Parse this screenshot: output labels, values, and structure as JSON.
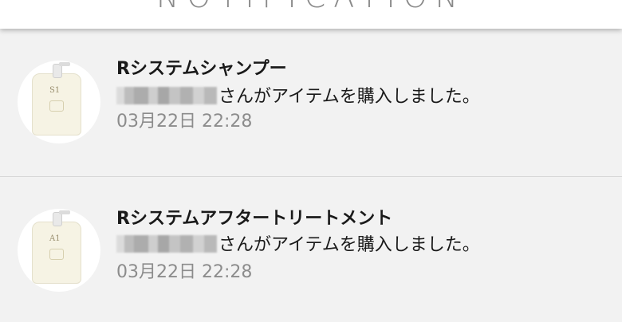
{
  "header": {
    "title": "NOTIFICATION"
  },
  "notifications": [
    {
      "product_name": "Rシステムシャンプー",
      "message": "さんがアイテムを購入しました。",
      "timestamp": "03月22日 22:28",
      "thumbnail_label": "S1"
    },
    {
      "product_name": "Rシステムアフタートリートメント",
      "message": "さんがアイテムを購入しました。",
      "timestamp": "03月22日 22:28",
      "thumbnail_label": "A1"
    }
  ],
  "colors": {
    "background": "#f2f2f2",
    "header_background": "#ffffff",
    "title_text": "#1a1a1a",
    "timestamp_text": "#8c8c8c",
    "divider": "#d8d8d8"
  }
}
